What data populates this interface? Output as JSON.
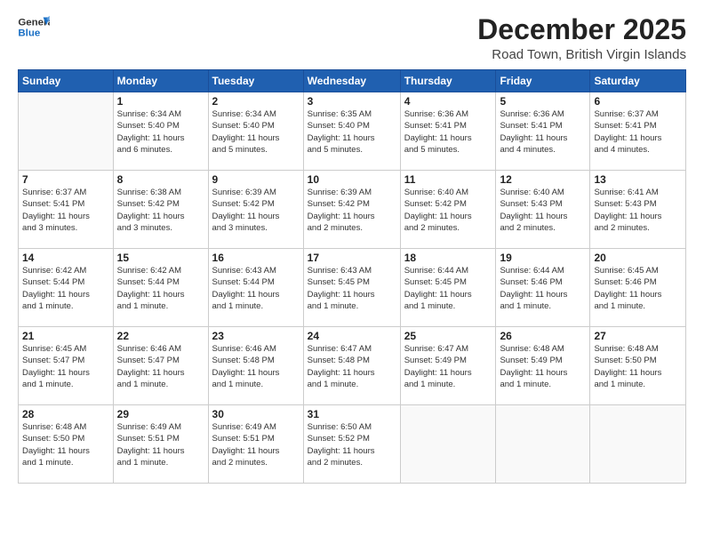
{
  "header": {
    "logo_line1": "General",
    "logo_line2": "Blue",
    "month_title": "December 2025",
    "subtitle": "Road Town, British Virgin Islands"
  },
  "weekdays": [
    "Sunday",
    "Monday",
    "Tuesday",
    "Wednesday",
    "Thursday",
    "Friday",
    "Saturday"
  ],
  "weeks": [
    [
      {
        "day": "",
        "info": ""
      },
      {
        "day": "1",
        "info": "Sunrise: 6:34 AM\nSunset: 5:40 PM\nDaylight: 11 hours\nand 6 minutes."
      },
      {
        "day": "2",
        "info": "Sunrise: 6:34 AM\nSunset: 5:40 PM\nDaylight: 11 hours\nand 5 minutes."
      },
      {
        "day": "3",
        "info": "Sunrise: 6:35 AM\nSunset: 5:40 PM\nDaylight: 11 hours\nand 5 minutes."
      },
      {
        "day": "4",
        "info": "Sunrise: 6:36 AM\nSunset: 5:41 PM\nDaylight: 11 hours\nand 5 minutes."
      },
      {
        "day": "5",
        "info": "Sunrise: 6:36 AM\nSunset: 5:41 PM\nDaylight: 11 hours\nand 4 minutes."
      },
      {
        "day": "6",
        "info": "Sunrise: 6:37 AM\nSunset: 5:41 PM\nDaylight: 11 hours\nand 4 minutes."
      }
    ],
    [
      {
        "day": "7",
        "info": "Sunrise: 6:37 AM\nSunset: 5:41 PM\nDaylight: 11 hours\nand 3 minutes."
      },
      {
        "day": "8",
        "info": "Sunrise: 6:38 AM\nSunset: 5:42 PM\nDaylight: 11 hours\nand 3 minutes."
      },
      {
        "day": "9",
        "info": "Sunrise: 6:39 AM\nSunset: 5:42 PM\nDaylight: 11 hours\nand 3 minutes."
      },
      {
        "day": "10",
        "info": "Sunrise: 6:39 AM\nSunset: 5:42 PM\nDaylight: 11 hours\nand 2 minutes."
      },
      {
        "day": "11",
        "info": "Sunrise: 6:40 AM\nSunset: 5:42 PM\nDaylight: 11 hours\nand 2 minutes."
      },
      {
        "day": "12",
        "info": "Sunrise: 6:40 AM\nSunset: 5:43 PM\nDaylight: 11 hours\nand 2 minutes."
      },
      {
        "day": "13",
        "info": "Sunrise: 6:41 AM\nSunset: 5:43 PM\nDaylight: 11 hours\nand 2 minutes."
      }
    ],
    [
      {
        "day": "14",
        "info": "Sunrise: 6:42 AM\nSunset: 5:44 PM\nDaylight: 11 hours\nand 1 minute."
      },
      {
        "day": "15",
        "info": "Sunrise: 6:42 AM\nSunset: 5:44 PM\nDaylight: 11 hours\nand 1 minute."
      },
      {
        "day": "16",
        "info": "Sunrise: 6:43 AM\nSunset: 5:44 PM\nDaylight: 11 hours\nand 1 minute."
      },
      {
        "day": "17",
        "info": "Sunrise: 6:43 AM\nSunset: 5:45 PM\nDaylight: 11 hours\nand 1 minute."
      },
      {
        "day": "18",
        "info": "Sunrise: 6:44 AM\nSunset: 5:45 PM\nDaylight: 11 hours\nand 1 minute."
      },
      {
        "day": "19",
        "info": "Sunrise: 6:44 AM\nSunset: 5:46 PM\nDaylight: 11 hours\nand 1 minute."
      },
      {
        "day": "20",
        "info": "Sunrise: 6:45 AM\nSunset: 5:46 PM\nDaylight: 11 hours\nand 1 minute."
      }
    ],
    [
      {
        "day": "21",
        "info": "Sunrise: 6:45 AM\nSunset: 5:47 PM\nDaylight: 11 hours\nand 1 minute."
      },
      {
        "day": "22",
        "info": "Sunrise: 6:46 AM\nSunset: 5:47 PM\nDaylight: 11 hours\nand 1 minute."
      },
      {
        "day": "23",
        "info": "Sunrise: 6:46 AM\nSunset: 5:48 PM\nDaylight: 11 hours\nand 1 minute."
      },
      {
        "day": "24",
        "info": "Sunrise: 6:47 AM\nSunset: 5:48 PM\nDaylight: 11 hours\nand 1 minute."
      },
      {
        "day": "25",
        "info": "Sunrise: 6:47 AM\nSunset: 5:49 PM\nDaylight: 11 hours\nand 1 minute."
      },
      {
        "day": "26",
        "info": "Sunrise: 6:48 AM\nSunset: 5:49 PM\nDaylight: 11 hours\nand 1 minute."
      },
      {
        "day": "27",
        "info": "Sunrise: 6:48 AM\nSunset: 5:50 PM\nDaylight: 11 hours\nand 1 minute."
      }
    ],
    [
      {
        "day": "28",
        "info": "Sunrise: 6:48 AM\nSunset: 5:50 PM\nDaylight: 11 hours\nand 1 minute."
      },
      {
        "day": "29",
        "info": "Sunrise: 6:49 AM\nSunset: 5:51 PM\nDaylight: 11 hours\nand 1 minute."
      },
      {
        "day": "30",
        "info": "Sunrise: 6:49 AM\nSunset: 5:51 PM\nDaylight: 11 hours\nand 2 minutes."
      },
      {
        "day": "31",
        "info": "Sunrise: 6:50 AM\nSunset: 5:52 PM\nDaylight: 11 hours\nand 2 minutes."
      },
      {
        "day": "",
        "info": ""
      },
      {
        "day": "",
        "info": ""
      },
      {
        "day": "",
        "info": ""
      }
    ]
  ]
}
